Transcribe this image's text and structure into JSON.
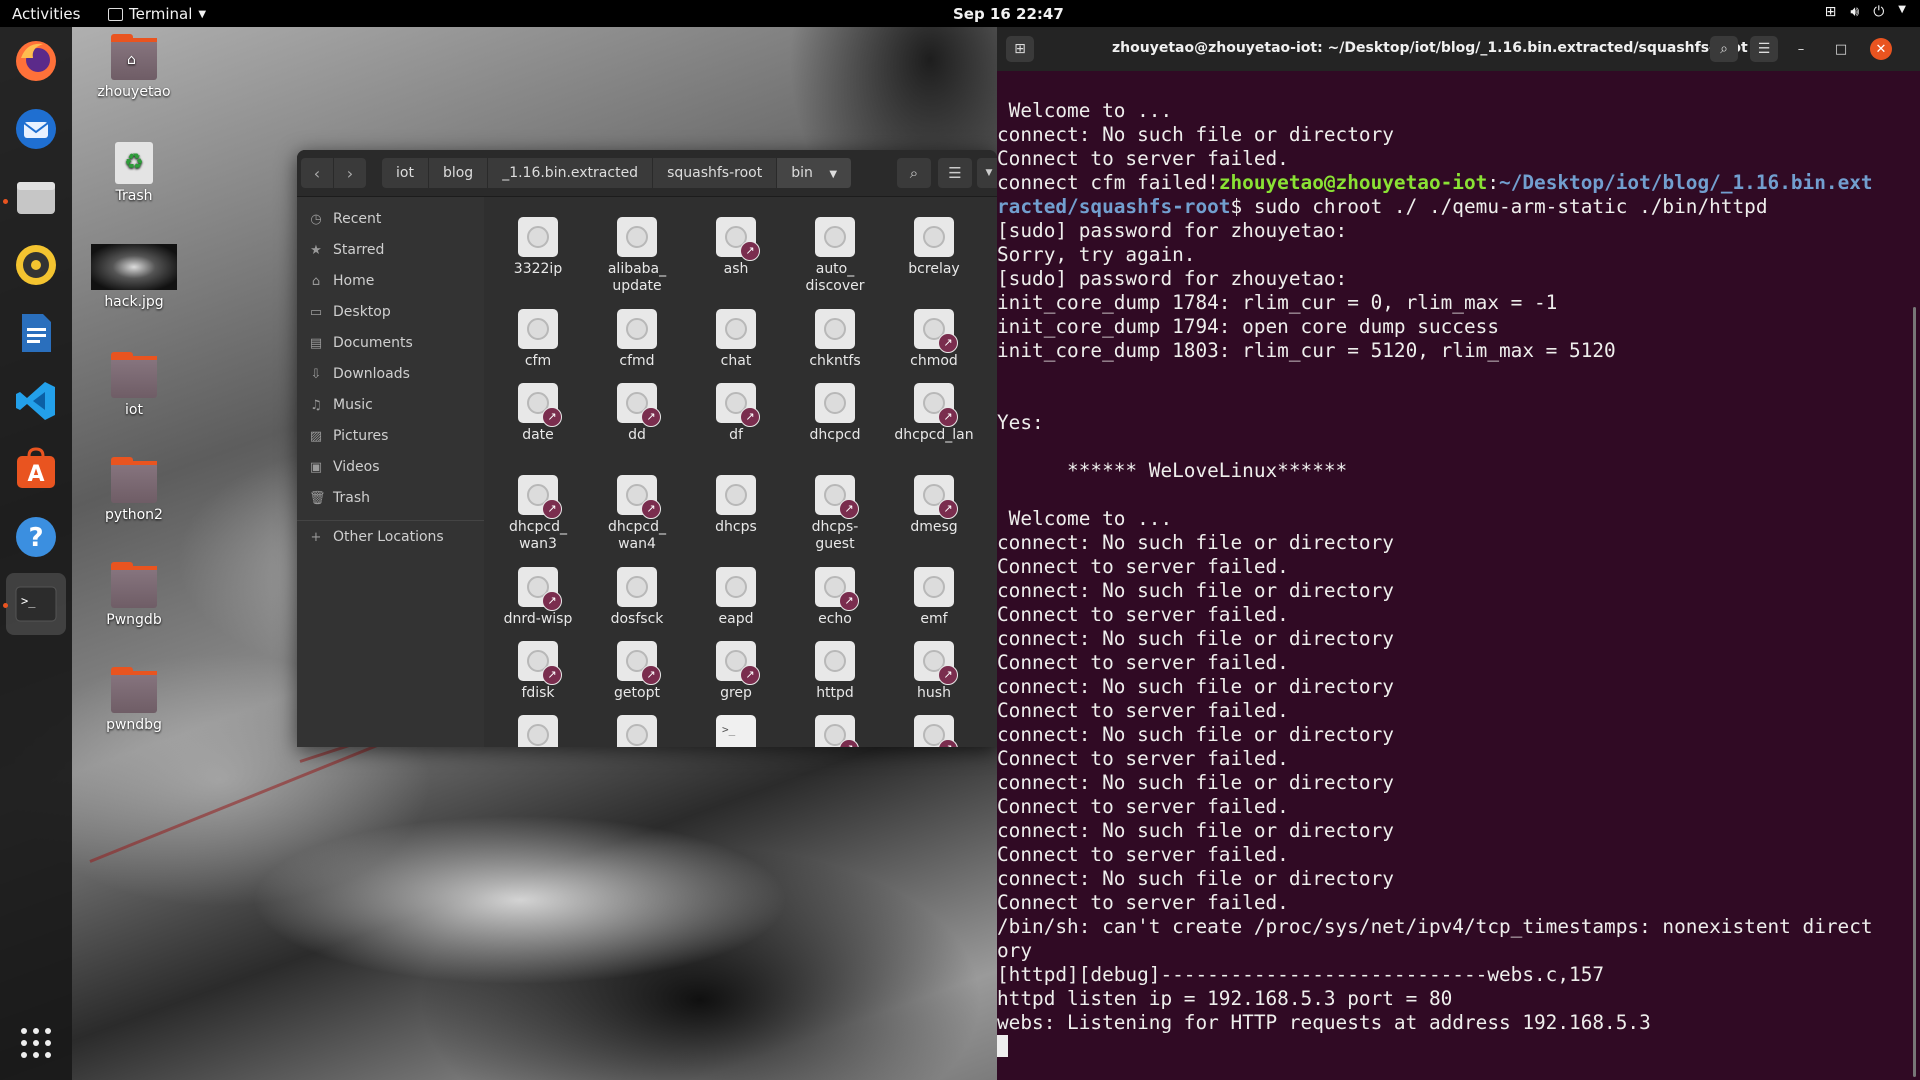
{
  "topbar": {
    "activities": "Activities",
    "app_name": "Terminal",
    "clock": "Sep 16  22:47",
    "tray_icons": [
      "network-icon",
      "volume-icon",
      "power-icon",
      "chevron-down-icon"
    ]
  },
  "dock": {
    "apps": [
      "firefox",
      "thunderbird",
      "files",
      "rhythmbox",
      "libreoffice-writer",
      "vscode",
      "app-center",
      "help",
      "terminal"
    ],
    "show_apps": "show-apps-grid-icon"
  },
  "desktop": {
    "icons": [
      {
        "label": "zhouyetao",
        "kind": "home-folder"
      },
      {
        "label": "Trash",
        "kind": "trash"
      },
      {
        "label": "hack.jpg",
        "kind": "image"
      },
      {
        "label": "iot",
        "kind": "folder"
      },
      {
        "label": "python2",
        "kind": "folder"
      },
      {
        "label": "Pwngdb",
        "kind": "folder"
      },
      {
        "label": "pwndbg",
        "kind": "folder"
      }
    ]
  },
  "files": {
    "breadcrumbs": [
      "iot",
      "blog",
      "_1.16.bin.extracted",
      "squashfs-root",
      "bin"
    ],
    "sidebar": [
      {
        "label": "Recent",
        "icon": "clock-icon"
      },
      {
        "label": "Starred",
        "icon": "star-icon"
      },
      {
        "label": "Home",
        "icon": "home-icon"
      },
      {
        "label": "Desktop",
        "icon": "desktop-icon"
      },
      {
        "label": "Documents",
        "icon": "documents-icon"
      },
      {
        "label": "Downloads",
        "icon": "downloads-icon"
      },
      {
        "label": "Music",
        "icon": "music-icon"
      },
      {
        "label": "Pictures",
        "icon": "pictures-icon"
      },
      {
        "label": "Videos",
        "icon": "videos-icon"
      },
      {
        "label": "Trash",
        "icon": "trash-icon"
      },
      {
        "label": "Other Locations",
        "icon": "plus-icon"
      }
    ],
    "items": [
      {
        "name": "3322ip",
        "link": false
      },
      {
        "name": "alibaba_\nupdate",
        "link": false
      },
      {
        "name": "ash",
        "link": true
      },
      {
        "name": "auto_\ndiscover",
        "link": false
      },
      {
        "name": "bcrelay",
        "link": false
      },
      {
        "name": "cfm",
        "link": false
      },
      {
        "name": "cfmd",
        "link": false
      },
      {
        "name": "chat",
        "link": false
      },
      {
        "name": "chkntfs",
        "link": false
      },
      {
        "name": "chmod",
        "link": true
      },
      {
        "name": "date",
        "link": true
      },
      {
        "name": "dd",
        "link": true
      },
      {
        "name": "df",
        "link": true
      },
      {
        "name": "dhcpcd",
        "link": false
      },
      {
        "name": "dhcpcd_lan",
        "link": true
      },
      {
        "name": "dhcpcd_\nwan3",
        "link": true
      },
      {
        "name": "dhcpcd_\nwan4",
        "link": true
      },
      {
        "name": "dhcps",
        "link": false
      },
      {
        "name": "dhcps-\nguest",
        "link": true
      },
      {
        "name": "dmesg",
        "link": true
      },
      {
        "name": "dnrd-wisp",
        "link": true
      },
      {
        "name": "dosfsck",
        "link": false
      },
      {
        "name": "eapd",
        "link": false
      },
      {
        "name": "echo",
        "link": true
      },
      {
        "name": "emf",
        "link": false
      },
      {
        "name": "fdisk",
        "link": true
      },
      {
        "name": "getopt",
        "link": true
      },
      {
        "name": "grep",
        "link": true
      },
      {
        "name": "httpd",
        "link": false
      },
      {
        "name": "hush",
        "link": true
      },
      {
        "name": "",
        "link": false
      },
      {
        "name": "",
        "link": false
      },
      {
        "name": "",
        "link": false,
        "terminal": true
      },
      {
        "name": "",
        "link": true
      },
      {
        "name": "",
        "link": true
      }
    ]
  },
  "terminal": {
    "title": "zhouyetao@zhouyetao-iot: ~/Desktop/iot/blog/_1.16.bin.extracted/squashfs-root",
    "lines": [
      {
        "text": " Welcome to ..."
      },
      {
        "text": "connect: No such file or directory"
      },
      {
        "text": "Connect to server failed."
      },
      {
        "pre": "connect cfm failed!",
        "user": "zhouyetao@zhouyetao-iot",
        "sep": ":",
        "path": "~/Desktop/iot/blog/_1.16.bin.ext"
      },
      {
        "path": "racted/squashfs-root",
        "post": "$ sudo chroot ./ ./qemu-arm-static ./bin/httpd"
      },
      {
        "text": "[sudo] password for zhouyetao:"
      },
      {
        "text": "Sorry, try again."
      },
      {
        "text": "[sudo] password for zhouyetao:"
      },
      {
        "text": "init_core_dump 1784: rlim_cur = 0, rlim_max = -1"
      },
      {
        "text": "init_core_dump 1794: open core dump success"
      },
      {
        "text": "init_core_dump 1803: rlim_cur = 5120, rlim_max = 5120"
      },
      {
        "text": ""
      },
      {
        "text": ""
      },
      {
        "text": "Yes:"
      },
      {
        "text": ""
      },
      {
        "text": "      ****** WeLoveLinux******"
      },
      {
        "text": ""
      },
      {
        "text": " Welcome to ..."
      },
      {
        "text": "connect: No such file or directory"
      },
      {
        "text": "Connect to server failed."
      },
      {
        "text": "connect: No such file or directory"
      },
      {
        "text": "Connect to server failed."
      },
      {
        "text": "connect: No such file or directory"
      },
      {
        "text": "Connect to server failed."
      },
      {
        "text": "connect: No such file or directory"
      },
      {
        "text": "Connect to server failed."
      },
      {
        "text": "connect: No such file or directory"
      },
      {
        "text": "Connect to server failed."
      },
      {
        "text": "connect: No such file or directory"
      },
      {
        "text": "Connect to server failed."
      },
      {
        "text": "connect: No such file or directory"
      },
      {
        "text": "Connect to server failed."
      },
      {
        "text": "connect: No such file or directory"
      },
      {
        "text": "Connect to server failed."
      },
      {
        "text": "/bin/sh: can't create /proc/sys/net/ipv4/tcp_timestamps: nonexistent direct"
      },
      {
        "text": "ory"
      },
      {
        "text": "[httpd][debug]----------------------------webs.c,157"
      },
      {
        "text": "httpd listen ip = 192.168.5.3 port = 80"
      },
      {
        "text": "webs: Listening for HTTP requests at address 192.168.5.3"
      }
    ]
  },
  "colors": {
    "terminal_bg": "#300a24",
    "prompt_user": "#8ae234",
    "prompt_path": "#729fcf",
    "accent": "#e95420",
    "symlink_badge": "#7a2d4e"
  }
}
